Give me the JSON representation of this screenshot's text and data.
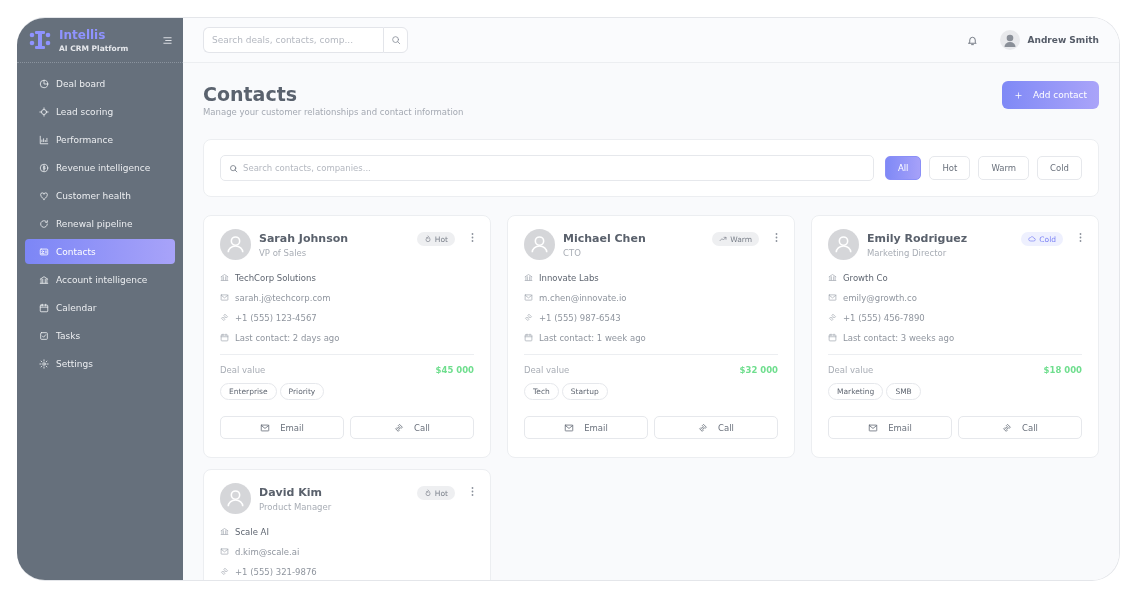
{
  "brand": {
    "name": "Intellis",
    "tagline": "AI CRM Platform"
  },
  "sidebar": {
    "items": [
      {
        "label": "Deal board",
        "selected": false
      },
      {
        "label": "Lead scoring",
        "selected": false
      },
      {
        "label": "Performance",
        "selected": false
      },
      {
        "label": "Revenue intelligence",
        "selected": false
      },
      {
        "label": "Customer health",
        "selected": false
      },
      {
        "label": "Renewal pipeline",
        "selected": false
      },
      {
        "label": "Contacts",
        "selected": true
      },
      {
        "label": "Account intelligence",
        "selected": false
      },
      {
        "label": "Calendar",
        "selected": false
      },
      {
        "label": "Tasks",
        "selected": false
      },
      {
        "label": "Settings",
        "selected": false
      }
    ]
  },
  "topbar": {
    "search": {
      "placeholder": "Search deals, contacts, comp..."
    },
    "user": {
      "name": "Andrew Smith"
    }
  },
  "page": {
    "title": "Contacts",
    "subtitle": "Manage your customer relationships and contact information",
    "add_button": "Add contact"
  },
  "filters": {
    "search": {
      "placeholder": "Search contacts, companies..."
    },
    "chips": [
      {
        "label": "All",
        "selected": true
      },
      {
        "label": "Hot",
        "selected": false
      },
      {
        "label": "Warm",
        "selected": false
      },
      {
        "label": "Cold",
        "selected": false
      }
    ]
  },
  "contacts": [
    {
      "name": "Sarah Johnson",
      "role": "VP of Sales",
      "status": {
        "kind": "hot",
        "label": "Hot"
      },
      "company": "TechCorp Solutions",
      "email": "sarah.j@techcorp.com",
      "phone": "+1 (555) 123-4567",
      "last_contact": "Last contact: 2 days ago",
      "deal_label": "Deal value",
      "deal_value": "$45 000",
      "tags": [
        "Enterprise",
        "Priority"
      ],
      "actions": [
        "Email",
        "Call"
      ]
    },
    {
      "name": "Michael Chen",
      "role": "CTO",
      "status": {
        "kind": "warm",
        "label": "Warm"
      },
      "company": "Innovate Labs",
      "email": "m.chen@innovate.io",
      "phone": "+1 (555) 987-6543",
      "last_contact": "Last contact: 1 week ago",
      "deal_label": "Deal value",
      "deal_value": "$32 000",
      "tags": [
        "Tech",
        "Startup"
      ],
      "actions": [
        "Email",
        "Call"
      ]
    },
    {
      "name": "Emily Rodriguez",
      "role": "Marketing Director",
      "status": {
        "kind": "cold",
        "label": "Cold"
      },
      "company": "Growth Co",
      "email": "emily@growth.co",
      "phone": "+1 (555) 456-7890",
      "last_contact": "Last contact: 3 weeks ago",
      "deal_label": "Deal value",
      "deal_value": "$18 000",
      "tags": [
        "Marketing",
        "SMB"
      ],
      "actions": [
        "Email",
        "Call"
      ]
    },
    {
      "name": "David Kim",
      "role": "Product Manager",
      "status": {
        "kind": "hot",
        "label": "Hot"
      },
      "company": "Scale AI",
      "email": "d.kim@scale.ai",
      "phone": "+1 (555) 321-9876"
    }
  ]
}
